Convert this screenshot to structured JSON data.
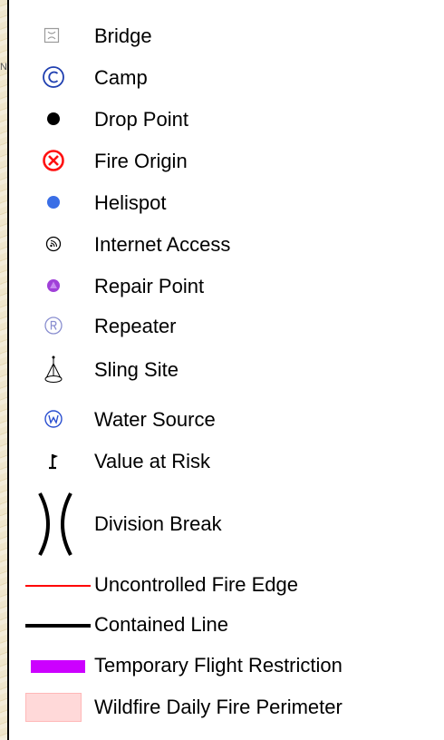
{
  "legend": {
    "items": [
      {
        "label": "Bridge",
        "icon": "bridge-icon"
      },
      {
        "label": "Camp",
        "icon": "camp-icon"
      },
      {
        "label": "Drop Point",
        "icon": "drop-point-icon"
      },
      {
        "label": "Fire Origin",
        "icon": "fire-origin-icon"
      },
      {
        "label": "Helispot",
        "icon": "helispot-icon"
      },
      {
        "label": "Internet Access",
        "icon": "internet-access-icon"
      },
      {
        "label": "Repair Point",
        "icon": "repair-point-icon"
      },
      {
        "label": "Repeater",
        "icon": "repeater-icon"
      },
      {
        "label": "Sling Site",
        "icon": "sling-site-icon"
      },
      {
        "label": "Water Source",
        "icon": "water-source-icon"
      },
      {
        "label": "Value at Risk",
        "icon": "value-at-risk-icon"
      },
      {
        "label": "Division Break",
        "icon": "division-break-icon"
      },
      {
        "label": "Uncontrolled Fire Edge",
        "icon": "uncontrolled-fire-edge-line",
        "color": "#ff0000"
      },
      {
        "label": "Contained Line",
        "icon": "contained-line",
        "color": "#000000"
      },
      {
        "label": "Temporary Flight Restriction",
        "icon": "tfr-swatch",
        "color": "#cc00ff"
      },
      {
        "label": "Wildfire Daily Fire Perimeter",
        "icon": "perimeter-swatch",
        "color": "#ffd9d9"
      }
    ],
    "glyphs": {
      "camp": "©",
      "repeater": "®",
      "water": "W"
    }
  }
}
